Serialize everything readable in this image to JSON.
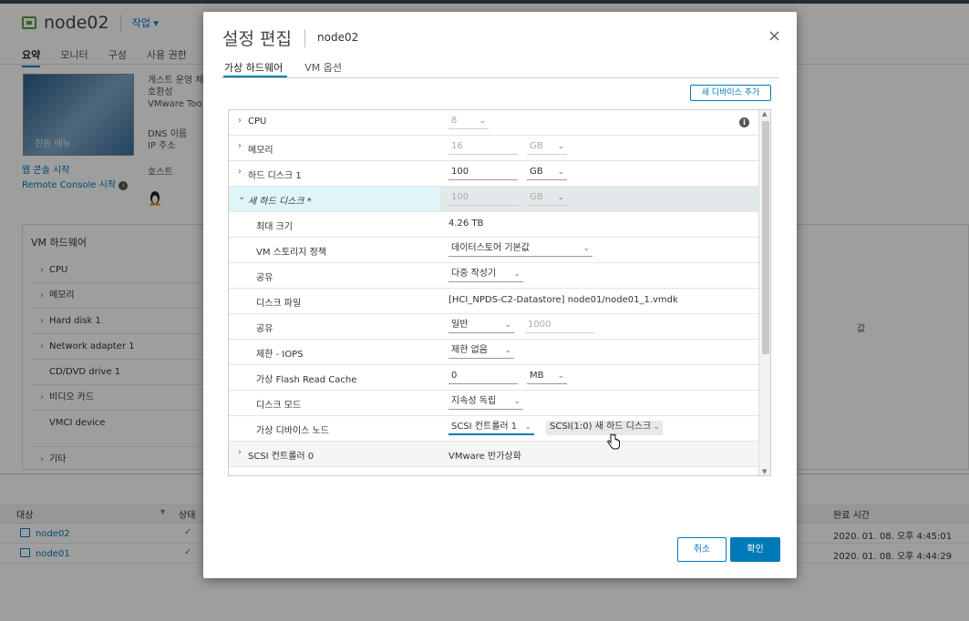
{
  "app": {
    "vm_name": "node02",
    "actions_label": "작업",
    "tabs": [
      "요약",
      "모니터",
      "구성",
      "사용 권한"
    ],
    "console_label": "진원 메뉴",
    "console_links": [
      "웹 콘솔 시작",
      "Remote Console 시작"
    ],
    "info_labels": [
      "게스트 운영 체",
      "호환성",
      "VMware Too",
      "DNS 이름",
      "IP 주소",
      "호스트"
    ],
    "hw_panel_title": "VM 하드웨어",
    "hw_rows": [
      "CPU",
      "메모리",
      "Hard disk 1",
      "Network adapter 1",
      "CD/DVD drive 1",
      "비디오 카드",
      "VMCI device",
      "기타"
    ],
    "hw_right_header": "값"
  },
  "tasks": {
    "headers": {
      "target": "대상",
      "status": "상태",
      "completion": "완료 시간"
    },
    "rows": [
      {
        "target": "node02",
        "status": "✓",
        "completion": "2020. 01. 08. 오후 4:45:01"
      },
      {
        "target": "node01",
        "status": "✓",
        "completion": "2020. 01. 08. 오후 4:44:29"
      }
    ]
  },
  "modal": {
    "title": "설정 편집",
    "subtitle": "node02",
    "close_symbol": "×",
    "tabs": [
      "가상 하드웨어",
      "VM 옵션"
    ],
    "add_device_label": "새 디바이스 추가",
    "info_symbol": "i",
    "rows": {
      "cpu": {
        "label": "CPU",
        "value": "8"
      },
      "memory": {
        "label": "메모리",
        "value": "16",
        "unit": "GB"
      },
      "disk1": {
        "label": "하드 디스크 1",
        "value": "100",
        "unit": "GB"
      },
      "newdisk": {
        "label": "새 하드 디스크 *",
        "value": "100",
        "unit": "GB"
      },
      "max_size": {
        "label": "최대 크기",
        "value": "4.26 TB"
      },
      "storage_policy": {
        "label": "VM 스토리지 정책",
        "value": "데이터스토어 기본값"
      },
      "sharing": {
        "label": "공유",
        "value": "다중 작성기"
      },
      "disk_file": {
        "label": "디스크 파일",
        "value": "[HCI_NPDS-C2-Datastore] node01/node01_1.vmdk"
      },
      "shares": {
        "label": "공유",
        "value": "일반",
        "value2": "1000"
      },
      "iops": {
        "label": "제한 - IOPS",
        "value": "제한 없음"
      },
      "flash_cache": {
        "label": "가상 Flash Read Cache",
        "value": "0",
        "unit": "MB"
      },
      "disk_mode": {
        "label": "디스크 모드",
        "value": "지속성 독립"
      },
      "device_node": {
        "label": "가상 디바이스 노드",
        "value": "SCSI 컨트롤러 1",
        "value2": "SCSI(1:0) 새 하드 디스크"
      },
      "scsi0": {
        "label": "SCSI 컨트롤러 0",
        "value": "VMware 반가상화"
      }
    },
    "cancel_label": "취소",
    "ok_label": "확인"
  },
  "colors": {
    "accent": "#0079b8",
    "highlight_row": "#dff5f8",
    "ok": "#3c8d2f"
  }
}
